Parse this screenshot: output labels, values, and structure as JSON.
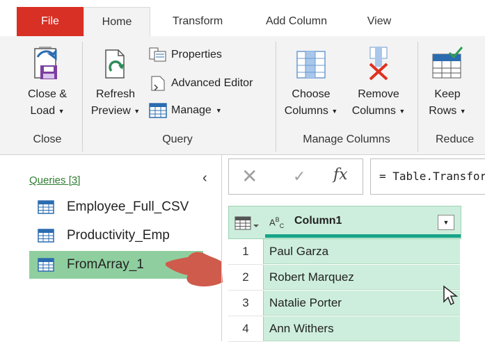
{
  "tabs": [
    "File",
    "Home",
    "Transform",
    "Add Column",
    "View"
  ],
  "ribbon": {
    "close_load": [
      "Close &",
      "Load"
    ],
    "refresh_preview": [
      "Refresh",
      "Preview"
    ],
    "properties": "Properties",
    "advanced_editor": "Advanced Editor",
    "manage": "Manage",
    "choose_columns": [
      "Choose",
      "Columns"
    ],
    "remove_columns": [
      "Remove",
      "Columns"
    ],
    "keep_rows": [
      "Keep",
      "Rows"
    ],
    "groups": [
      "Close",
      "Query",
      "Manage Columns",
      "Reduce"
    ]
  },
  "queries": {
    "title": "Queries [3]",
    "items": [
      "Employee_Full_CSV",
      "Productivity_Emp",
      "FromArray_1"
    ]
  },
  "formula": "= Table.Transform",
  "table": {
    "type_label_a": "A",
    "type_label_b": "B",
    "type_label_c": "C",
    "column": "Column1",
    "row_numbers": [
      "1",
      "2",
      "3",
      "4"
    ],
    "rows": [
      "Paul Garza",
      "Robert Marquez",
      "Natalie Porter",
      "Ann Withers"
    ]
  },
  "colors": {
    "file_tab": "#d93025",
    "selected_query": "#8fcf9f",
    "grid_cell": "#cdeedc",
    "accent": "#17a589",
    "arrow": "#d0584a"
  }
}
